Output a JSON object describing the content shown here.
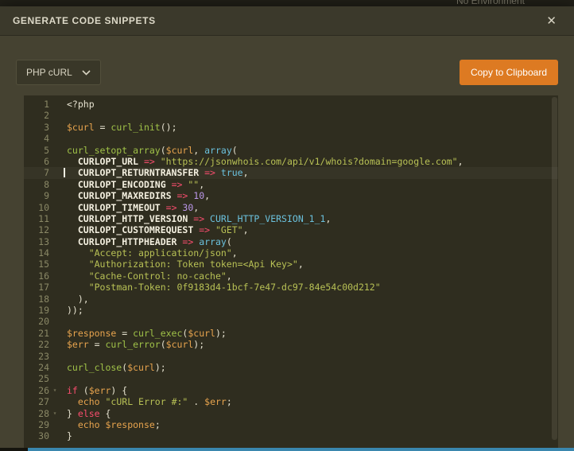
{
  "backdrop": {
    "top_right_text": "No Environment"
  },
  "modal": {
    "title": "GENERATE CODE SNIPPETS",
    "close_icon": "✕"
  },
  "toolbar": {
    "language_label": "PHP cURL",
    "copy_button_label": "Copy to Clipboard"
  },
  "colors": {
    "accent_orange": "#dd7a22",
    "modal_header_bg": "#3b392b",
    "modal_body_bg": "#454231",
    "editor_bg": "#2f2d1f",
    "gutter_text": "#8a8866",
    "tok_plain": "#e6e2d0",
    "tok_var": "#e8a44e",
    "tok_func": "#a0c248",
    "tok_const": "#f4f0e0",
    "tok_op": "#f94d6e",
    "tok_str": "#b8c155",
    "tok_num": "#bb97ea",
    "tok_builtin": "#6bc1dd",
    "tok_keyword": "#f94d6e",
    "bottom_bar_blue": "#3a87ae"
  },
  "editor": {
    "fold_marker": "▾",
    "lines": [
      {
        "num": 1,
        "seg": [
          [
            "p",
            "<?php"
          ]
        ]
      },
      {
        "num": 2,
        "seg": []
      },
      {
        "num": 3,
        "seg": [
          [
            "v",
            "$curl"
          ],
          [
            "p",
            " = "
          ],
          [
            "f",
            "curl_init"
          ],
          [
            "p",
            "();"
          ]
        ]
      },
      {
        "num": 4,
        "seg": []
      },
      {
        "num": 5,
        "seg": [
          [
            "f",
            "curl_setopt_array"
          ],
          [
            "p",
            "("
          ],
          [
            "v",
            "$curl"
          ],
          [
            "p",
            ", "
          ],
          [
            "b",
            "array"
          ],
          [
            "p",
            "("
          ]
        ]
      },
      {
        "num": 6,
        "seg": [
          [
            "p",
            "  "
          ],
          [
            "c",
            "CURLOPT_URL"
          ],
          [
            "o",
            " => "
          ],
          [
            "s",
            "\"https://jsonwhois.com/api/v1/whois?domain=google.com\""
          ],
          [
            "p",
            ","
          ]
        ]
      },
      {
        "num": 7,
        "caret": true,
        "seg": [
          [
            "p",
            "  "
          ],
          [
            "c",
            "CURLOPT_RETURNTRANSFER"
          ],
          [
            "o",
            " => "
          ],
          [
            "b",
            "true"
          ],
          [
            "p",
            ","
          ]
        ]
      },
      {
        "num": 8,
        "seg": [
          [
            "p",
            "  "
          ],
          [
            "c",
            "CURLOPT_ENCODING"
          ],
          [
            "o",
            " => "
          ],
          [
            "s",
            "\"\""
          ],
          [
            "p",
            ","
          ]
        ]
      },
      {
        "num": 9,
        "seg": [
          [
            "p",
            "  "
          ],
          [
            "c",
            "CURLOPT_MAXREDIRS"
          ],
          [
            "o",
            " => "
          ],
          [
            "n",
            "10"
          ],
          [
            "p",
            ","
          ]
        ]
      },
      {
        "num": 10,
        "seg": [
          [
            "p",
            "  "
          ],
          [
            "c",
            "CURLOPT_TIMEOUT"
          ],
          [
            "o",
            " => "
          ],
          [
            "n",
            "30"
          ],
          [
            "p",
            ","
          ]
        ]
      },
      {
        "num": 11,
        "seg": [
          [
            "p",
            "  "
          ],
          [
            "c",
            "CURLOPT_HTTP_VERSION"
          ],
          [
            "o",
            " => "
          ],
          [
            "b",
            "CURL_HTTP_VERSION_1_1"
          ],
          [
            "p",
            ","
          ]
        ]
      },
      {
        "num": 12,
        "seg": [
          [
            "p",
            "  "
          ],
          [
            "c",
            "CURLOPT_CUSTOMREQUEST"
          ],
          [
            "o",
            " => "
          ],
          [
            "s",
            "\"GET\""
          ],
          [
            "p",
            ","
          ]
        ]
      },
      {
        "num": 13,
        "seg": [
          [
            "p",
            "  "
          ],
          [
            "c",
            "CURLOPT_HTTPHEADER"
          ],
          [
            "o",
            " => "
          ],
          [
            "b",
            "array"
          ],
          [
            "p",
            "("
          ]
        ]
      },
      {
        "num": 14,
        "seg": [
          [
            "p",
            "    "
          ],
          [
            "s",
            "\"Accept: application/json\""
          ],
          [
            "p",
            ","
          ]
        ]
      },
      {
        "num": 15,
        "seg": [
          [
            "p",
            "    "
          ],
          [
            "s",
            "\"Authorization: Token token=<Api Key>\""
          ],
          [
            "p",
            ","
          ]
        ]
      },
      {
        "num": 16,
        "seg": [
          [
            "p",
            "    "
          ],
          [
            "s",
            "\"Cache-Control: no-cache\""
          ],
          [
            "p",
            ","
          ]
        ]
      },
      {
        "num": 17,
        "seg": [
          [
            "p",
            "    "
          ],
          [
            "s",
            "\"Postman-Token: 0f9183d4-1bcf-7e47-dc97-84e54c00d212\""
          ]
        ]
      },
      {
        "num": 18,
        "seg": [
          [
            "p",
            "  ),"
          ]
        ]
      },
      {
        "num": 19,
        "seg": [
          [
            "p",
            "));"
          ]
        ]
      },
      {
        "num": 20,
        "seg": []
      },
      {
        "num": 21,
        "seg": [
          [
            "v",
            "$response"
          ],
          [
            "p",
            " = "
          ],
          [
            "f",
            "curl_exec"
          ],
          [
            "p",
            "("
          ],
          [
            "v",
            "$curl"
          ],
          [
            "p",
            ");"
          ]
        ]
      },
      {
        "num": 22,
        "seg": [
          [
            "v",
            "$err"
          ],
          [
            "p",
            " = "
          ],
          [
            "f",
            "curl_error"
          ],
          [
            "p",
            "("
          ],
          [
            "v",
            "$curl"
          ],
          [
            "p",
            ");"
          ]
        ]
      },
      {
        "num": 23,
        "seg": []
      },
      {
        "num": 24,
        "seg": [
          [
            "f",
            "curl_close"
          ],
          [
            "p",
            "("
          ],
          [
            "v",
            "$curl"
          ],
          [
            "p",
            ");"
          ]
        ]
      },
      {
        "num": 25,
        "seg": []
      },
      {
        "num": 26,
        "fold": true,
        "seg": [
          [
            "k",
            "if"
          ],
          [
            "p",
            " ("
          ],
          [
            "v",
            "$err"
          ],
          [
            "p",
            ") {"
          ]
        ]
      },
      {
        "num": 27,
        "seg": [
          [
            "p",
            "  "
          ],
          [
            "v",
            "echo"
          ],
          [
            "p",
            " "
          ],
          [
            "s",
            "\"cURL Error #:\""
          ],
          [
            "p",
            " . "
          ],
          [
            "v",
            "$err"
          ],
          [
            "p",
            ";"
          ]
        ]
      },
      {
        "num": 28,
        "fold": true,
        "seg": [
          [
            "p",
            "} "
          ],
          [
            "k",
            "else"
          ],
          [
            "p",
            " {"
          ]
        ]
      },
      {
        "num": 29,
        "seg": [
          [
            "p",
            "  "
          ],
          [
            "v",
            "echo"
          ],
          [
            "p",
            " "
          ],
          [
            "v",
            "$response"
          ],
          [
            "p",
            ";"
          ]
        ]
      },
      {
        "num": 30,
        "seg": [
          [
            "p",
            "}"
          ]
        ]
      }
    ]
  }
}
